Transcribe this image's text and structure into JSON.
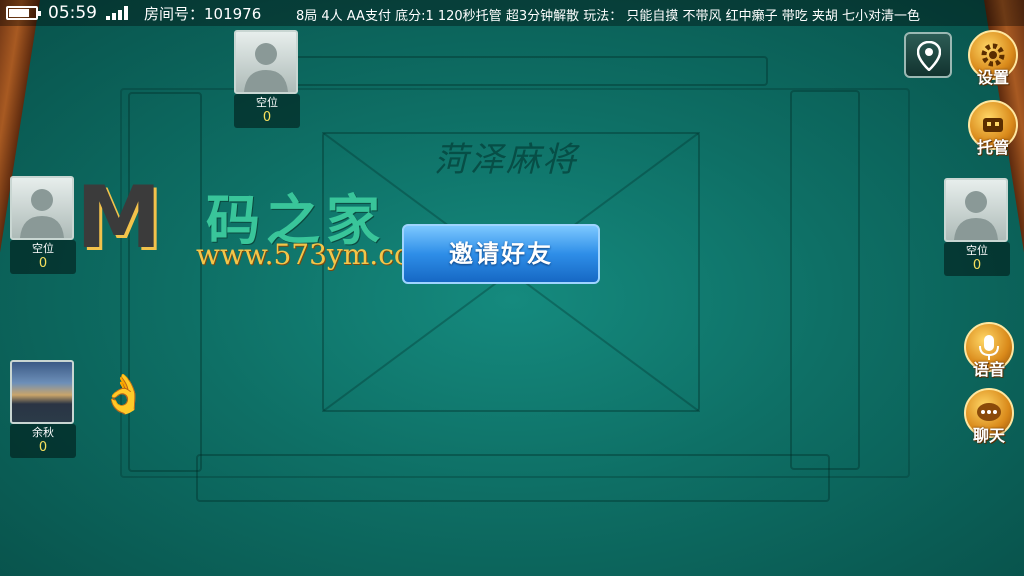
{
  "status_bar": {
    "time": "05:59",
    "battery_level": 0.75,
    "room_label": "房间号：101976",
    "rules": "8局 4人 AA支付 底分:1 120秒托管 超3分钟解散 玩法： 只能自摸 不带风 红中癞子 带吃 夹胡 七小对清一色"
  },
  "table": {
    "logo_text": "菏泽麻将"
  },
  "seats": {
    "top": {
      "name": "空位",
      "score": "0"
    },
    "left": {
      "name": "空位",
      "score": "0"
    },
    "right": {
      "name": "空位",
      "score": "0"
    },
    "self": {
      "name": "余秋",
      "score": "0"
    }
  },
  "watermark": {
    "logo": "M",
    "title": "码之家",
    "url": "www.573ym.com"
  },
  "invite_button": {
    "label": "邀请好友"
  },
  "side_buttons": {
    "settings": "设置",
    "auto_play": "托管",
    "voice": "语音",
    "chat": "聊天"
  },
  "icons": {
    "ok_hand": "👌"
  },
  "colors": {
    "felt": "#0e6f65",
    "invite_button": "#2e8ee8",
    "side_button": "#d9891a",
    "score": "#f6e05e"
  }
}
